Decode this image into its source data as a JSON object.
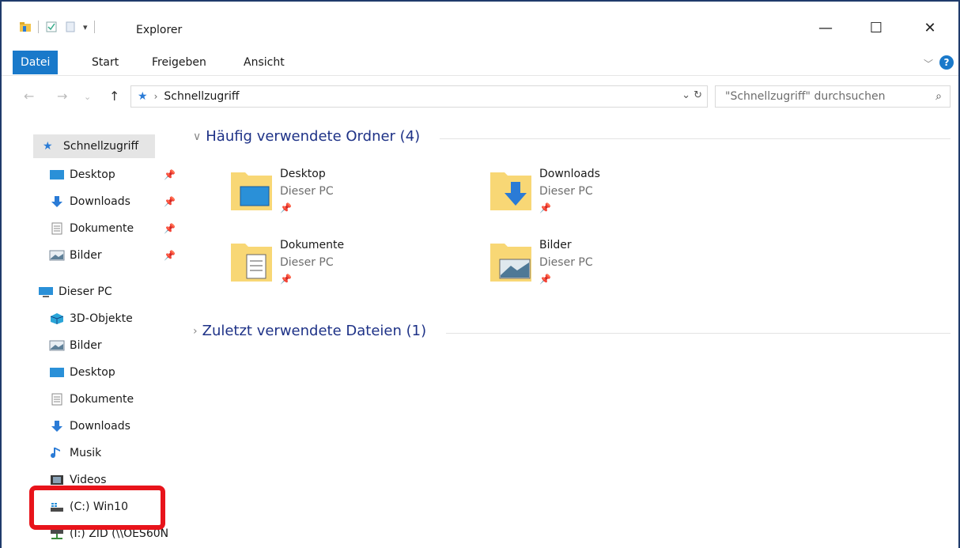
{
  "window": {
    "title": "Explorer",
    "controls": {
      "minimize": "—",
      "maximize": "☐",
      "close": "✕"
    }
  },
  "ribbon": {
    "tabs": [
      {
        "label": "Datei",
        "active": true
      },
      {
        "label": "Start",
        "active": false
      },
      {
        "label": "Freigeben",
        "active": false
      },
      {
        "label": "Ansicht",
        "active": false
      }
    ],
    "help": "?"
  },
  "address": {
    "path": "Schnellzugriff",
    "search_placeholder": "\"Schnellzugriff\" durchsuchen"
  },
  "sidebar": {
    "quick_access": "Schnellzugriff",
    "pinned": [
      {
        "label": "Desktop",
        "icon": "desktop-icon"
      },
      {
        "label": "Downloads",
        "icon": "download-icon"
      },
      {
        "label": "Dokumente",
        "icon": "document-icon"
      },
      {
        "label": "Bilder",
        "icon": "pictures-icon"
      }
    ],
    "this_pc": "Dieser PC",
    "pc_items": [
      {
        "label": "3D-Objekte",
        "icon": "3d-objects-icon"
      },
      {
        "label": "Bilder",
        "icon": "pictures-icon"
      },
      {
        "label": "Desktop",
        "icon": "desktop-icon"
      },
      {
        "label": "Dokumente",
        "icon": "document-icon"
      },
      {
        "label": "Downloads",
        "icon": "download-icon"
      },
      {
        "label": "Musik",
        "icon": "music-icon"
      },
      {
        "label": "Videos",
        "icon": "video-icon"
      },
      {
        "label": "(C:) Win10",
        "icon": "drive-icon"
      },
      {
        "label": "(I:) ZID (\\\\OES60N",
        "icon": "network-drive-icon"
      }
    ]
  },
  "main": {
    "frequent_header": "Häufig verwendete Ordner (4)",
    "recent_header": "Zuletzt verwendete Dateien (1)",
    "folders": [
      {
        "name": "Desktop",
        "location": "Dieser PC"
      },
      {
        "name": "Downloads",
        "location": "Dieser PC"
      },
      {
        "name": "Dokumente",
        "location": "Dieser PC"
      },
      {
        "name": "Bilder",
        "location": "Dieser PC"
      }
    ]
  },
  "colors": {
    "accent": "#1979ca",
    "highlight": "#e8141b",
    "header_text": "#1e3287"
  }
}
